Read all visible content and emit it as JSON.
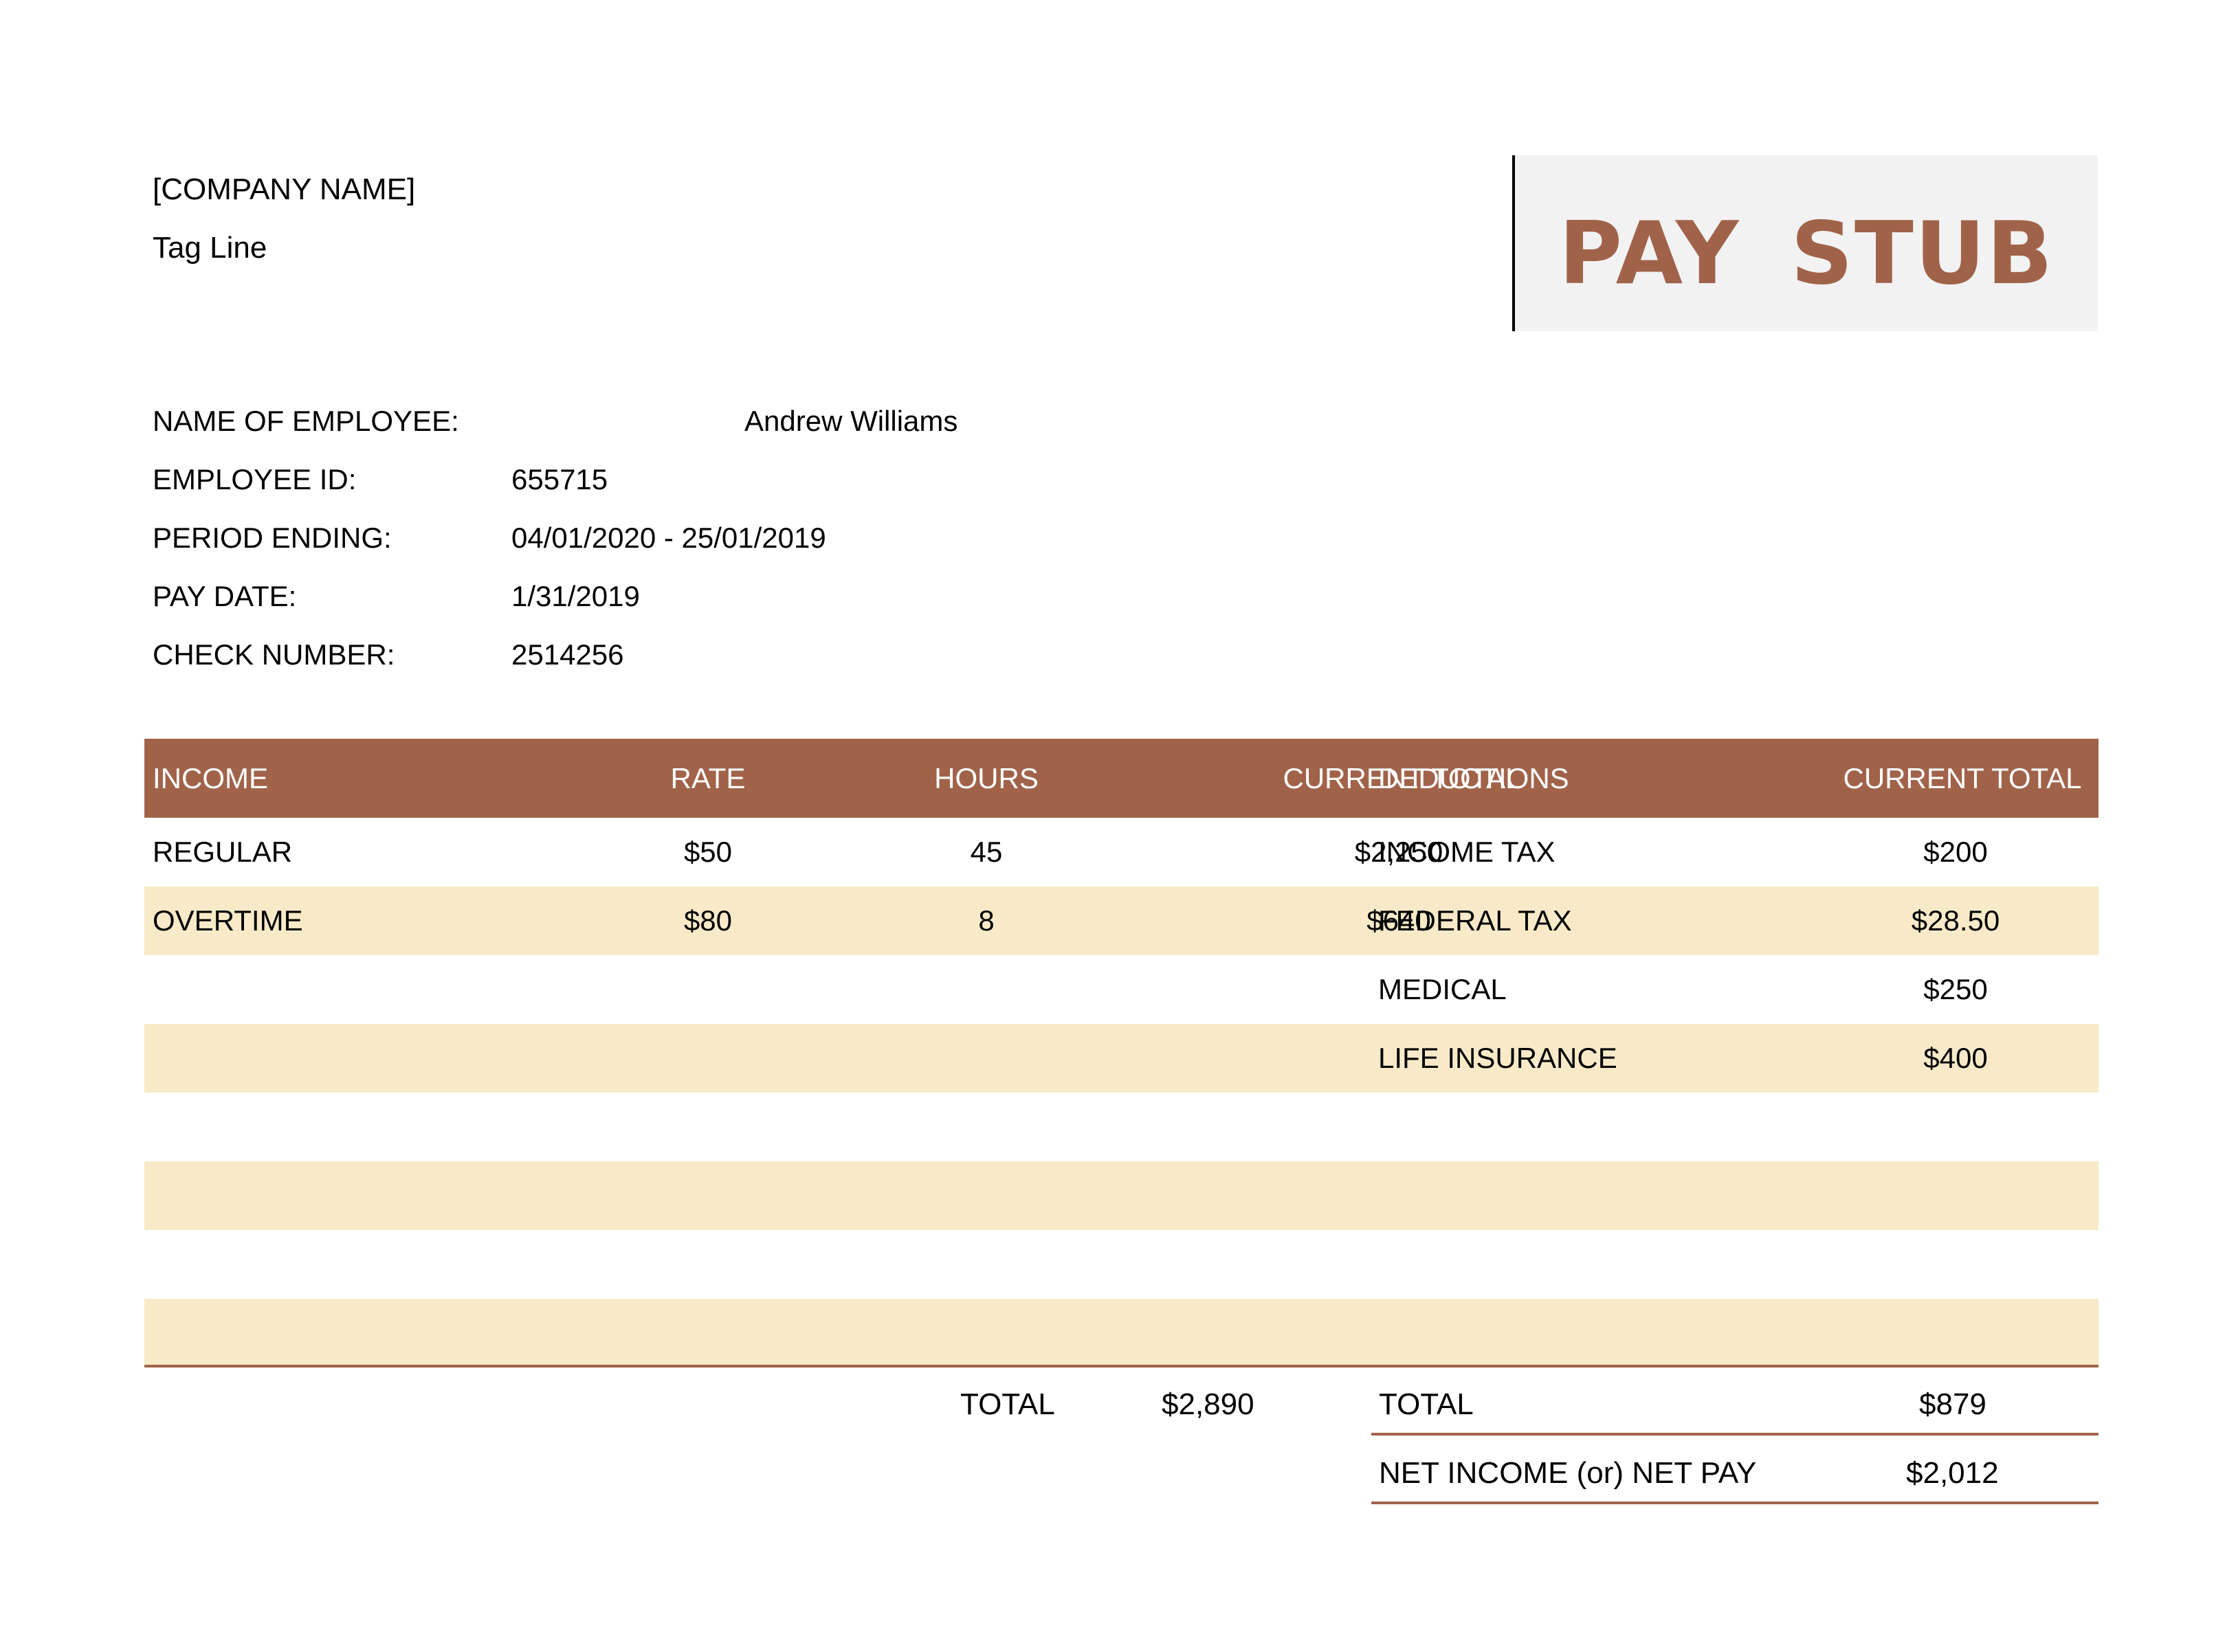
{
  "header": {
    "company_name": "[COMPANY NAME]",
    "tag_line": "Tag Line",
    "title": "PAY  STUB"
  },
  "employee": {
    "name_label": "NAME OF EMPLOYEE:",
    "name_value": "Andrew Williams",
    "id_label": "EMPLOYEE ID:",
    "id_value": "655715",
    "period_label": "PERIOD ENDING:",
    "period_value": "04/01/2020 - 25/01/2019",
    "pay_date_label": "PAY DATE:",
    "pay_date_value": "1/31/2019",
    "check_label": "CHECK NUMBER:",
    "check_value": "2514256"
  },
  "table": {
    "headers": [
      "INCOME",
      "RATE",
      "HOURS",
      "CURRENT TOTAL",
      "DEDUCTIONS",
      "CURRENT TOTAL"
    ],
    "rows": [
      [
        "REGULAR",
        "$50",
        "45",
        "$2,250",
        "INCOME TAX",
        "$200"
      ],
      [
        "OVERTIME",
        "$80",
        "8",
        "$640",
        "FEDERAL TAX",
        "$28.50"
      ],
      [
        "",
        "",
        "",
        "",
        "MEDICAL",
        "$250"
      ],
      [
        "",
        "",
        "",
        "",
        "LIFE INSURANCE",
        "$400"
      ],
      [
        "",
        "",
        "",
        "",
        "",
        ""
      ],
      [
        "",
        "",
        "",
        "",
        "",
        ""
      ],
      [
        "",
        "",
        "",
        "",
        "",
        ""
      ],
      [
        "",
        "",
        "",
        "",
        "",
        ""
      ]
    ]
  },
  "totals": {
    "income_total_label": "TOTAL",
    "income_total_value": "$2,890",
    "deductions_total_label": "TOTAL",
    "deductions_total_value": "$879",
    "net_pay_label": "NET INCOME (or) NET PAY",
    "net_pay_value": "$2,012"
  },
  "colors": {
    "accent": "#a0634a",
    "row_shade": "#f8eac8",
    "title_bg": "#f2f2f2"
  }
}
